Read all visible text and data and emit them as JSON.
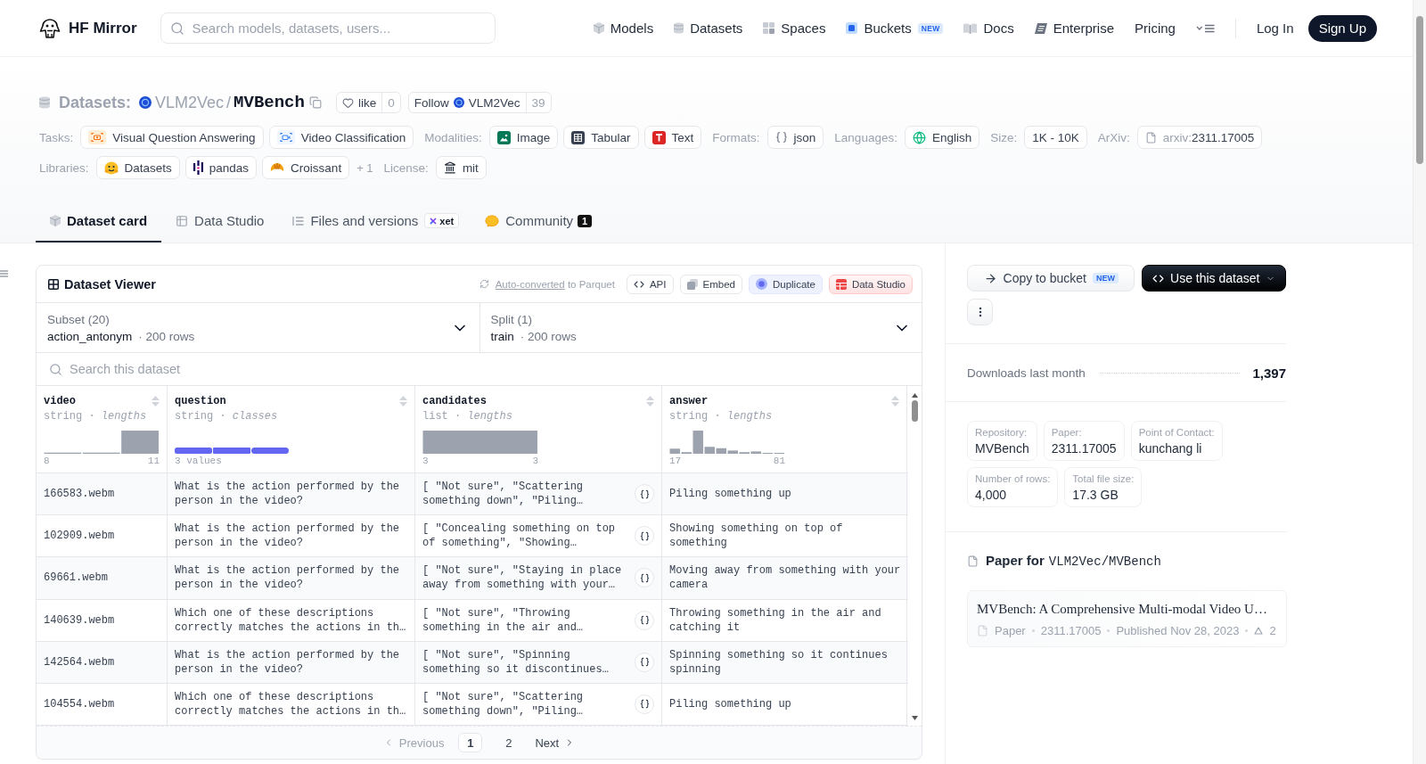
{
  "header": {
    "brand": "HF Mirror",
    "search": {
      "placeholder": "Search models, datasets, users..."
    },
    "nav": [
      {
        "label": "Models"
      },
      {
        "label": "Datasets"
      },
      {
        "label": "Spaces"
      },
      {
        "label": "Buckets",
        "badge": "NEW"
      },
      {
        "label": "Docs"
      },
      {
        "label": "Enterprise"
      },
      {
        "label": "Pricing"
      }
    ],
    "log_in": "Log In",
    "sign_up": "Sign Up"
  },
  "repo": {
    "type_label": "Datasets:",
    "owner": "VLM2Vec",
    "separator": "/",
    "name": "MVBench",
    "like": {
      "label": "like",
      "count": "0"
    },
    "follow": {
      "label": "Follow",
      "org": "VLM2Vec",
      "count": "39"
    }
  },
  "tag_rows": [
    {
      "groups": [
        {
          "label": "Tasks:",
          "tags": [
            {
              "text": "Visual Question Answering"
            },
            {
              "text": "Video Classification"
            }
          ]
        },
        {
          "label": "Modalities:",
          "tags": [
            {
              "text": "Image"
            },
            {
              "text": "Tabular"
            },
            {
              "text": "Text"
            }
          ]
        },
        {
          "label": "Formats:",
          "tags": [
            {
              "text": "json"
            }
          ]
        },
        {
          "label": "Languages:",
          "tags": [
            {
              "text": "English"
            }
          ]
        },
        {
          "label": "Size:",
          "tags": [
            {
              "text": "1K - 10K"
            }
          ]
        },
        {
          "label": "ArXiv:",
          "tags": [
            {
              "prefix": "arxiv:",
              "text": "2311.17005"
            }
          ]
        }
      ]
    },
    {
      "groups": [
        {
          "label": "Libraries:",
          "tags": [
            {
              "text": "Datasets"
            },
            {
              "text": "pandas"
            },
            {
              "text": "Croissant"
            }
          ],
          "more": "+ 1"
        },
        {
          "label": "License:",
          "tags": [
            {
              "text": "mit"
            }
          ]
        }
      ]
    }
  ],
  "tabs": [
    {
      "label": "Dataset card",
      "selected": true
    },
    {
      "label": "Data Studio",
      "selected": false
    },
    {
      "label": "Files and versions",
      "selected": false,
      "badge": "xet"
    },
    {
      "label": "Community",
      "selected": false,
      "count": "1"
    }
  ],
  "viewer": {
    "title": "Dataset Viewer",
    "conversion": {
      "link": "Auto-converted",
      "text": "to Parquet"
    },
    "actions": [
      {
        "label": "API",
        "kind": "plain"
      },
      {
        "label": "Embed",
        "kind": "plain"
      },
      {
        "label": "Duplicate",
        "kind": "accent"
      },
      {
        "label": "Data Studio",
        "kind": "studio"
      }
    ],
    "selects": [
      {
        "label": "Subset (20)",
        "value": "action_antonym",
        "meta": "· 200 rows"
      },
      {
        "label": "Split (1)",
        "value": "train",
        "meta": "· 200 rows"
      }
    ],
    "search": {
      "placeholder": "Search this dataset"
    },
    "columns": [
      {
        "name": "video",
        "type": "string · *lengths*",
        "kind": "histogram",
        "min": "8",
        "max": "11"
      },
      {
        "name": "question",
        "type": "string · *classes*",
        "kind": "classes",
        "summary": "3 values"
      },
      {
        "name": "candidates",
        "type": "list · *lengths*",
        "kind": "histogram",
        "min": "3",
        "max": "3"
      },
      {
        "name": "answer",
        "type": "string · *lengths*",
        "kind": "histogram",
        "min": "17",
        "max": "81"
      }
    ],
    "rows": [
      {
        "cells": [
          {
            "kind": "text",
            "text": "166583.webm"
          },
          {
            "kind": "text",
            "text": "What is the action performed by the person in the video?"
          },
          {
            "kind": "list",
            "text": "[ \"Not sure\", \"Scattering something down\", \"Piling…"
          },
          {
            "kind": "text",
            "text": "Piling something up"
          }
        ]
      },
      {
        "cells": [
          {
            "kind": "text",
            "text": "102909.webm"
          },
          {
            "kind": "text",
            "text": "What is the action performed by the person in the video?"
          },
          {
            "kind": "list",
            "text": "[ \"Concealing something on top of something\", \"Showing…"
          },
          {
            "kind": "text",
            "text": "Showing something on top of something"
          }
        ]
      },
      {
        "cells": [
          {
            "kind": "text",
            "text": "69661.webm"
          },
          {
            "kind": "text",
            "text": "What is the action performed by the person in the video?"
          },
          {
            "kind": "list",
            "text": "[ \"Not sure\", \"Staying in place away from something with your…"
          },
          {
            "kind": "text",
            "text": "Moving away from something with your camera"
          }
        ]
      },
      {
        "cells": [
          {
            "kind": "text",
            "text": "140639.webm"
          },
          {
            "kind": "text",
            "text": "Which one of these descriptions correctly matches the actions in th…"
          },
          {
            "kind": "list",
            "text": "[ \"Not sure\", \"Throwing something in the air and…"
          },
          {
            "kind": "text",
            "text": "Throwing something in the air and catching it"
          }
        ]
      },
      {
        "cells": [
          {
            "kind": "text",
            "text": "142564.webm"
          },
          {
            "kind": "text",
            "text": "What is the action performed by the person in the video?"
          },
          {
            "kind": "list",
            "text": "[ \"Not sure\", \"Spinning something so it discontinues…"
          },
          {
            "kind": "text",
            "text": "Spinning something so it continues spinning"
          }
        ]
      },
      {
        "cells": [
          {
            "kind": "text",
            "text": "104554.webm"
          },
          {
            "kind": "text",
            "text": "Which one of these descriptions correctly matches the actions in th…"
          },
          {
            "kind": "list",
            "text": "[ \"Not sure\", \"Scattering something down\", \"Piling…"
          },
          {
            "kind": "text",
            "text": "Piling something up"
          }
        ]
      }
    ],
    "pagination": {
      "previous": {
        "label": "Previous",
        "disabled": true
      },
      "pages": [
        {
          "label": "1",
          "selected": true
        },
        {
          "label": "2",
          "selected": false
        }
      ],
      "next": {
        "label": "Next",
        "disabled": false
      }
    }
  },
  "sidebar": {
    "actions": [
      {
        "label": "Copy to bucket",
        "badge": "NEW",
        "kind": "secondary"
      },
      {
        "label": "Use this dataset",
        "kind": "primary"
      }
    ],
    "downloads": {
      "label": "Downloads last month",
      "value": "1,397"
    },
    "info": [
      {
        "label": "Repository:",
        "value": "MVBench"
      },
      {
        "label": "Paper:",
        "value": "2311.17005"
      },
      {
        "label": "Point of Contact:",
        "value": "kunchang li"
      },
      {
        "label": "Number of rows:",
        "value": "4,000"
      },
      {
        "label": "Total file size:",
        "value": "17.3 GB"
      }
    ],
    "paper": {
      "heading": "Paper for",
      "repo": "VLM2Vec/MVBench",
      "title": "MVBench: A Comprehensive Multi-modal Video U…",
      "type": "Paper",
      "id": "2311.17005",
      "published": "Published Nov 28, 2023",
      "upvotes": "2"
    }
  }
}
